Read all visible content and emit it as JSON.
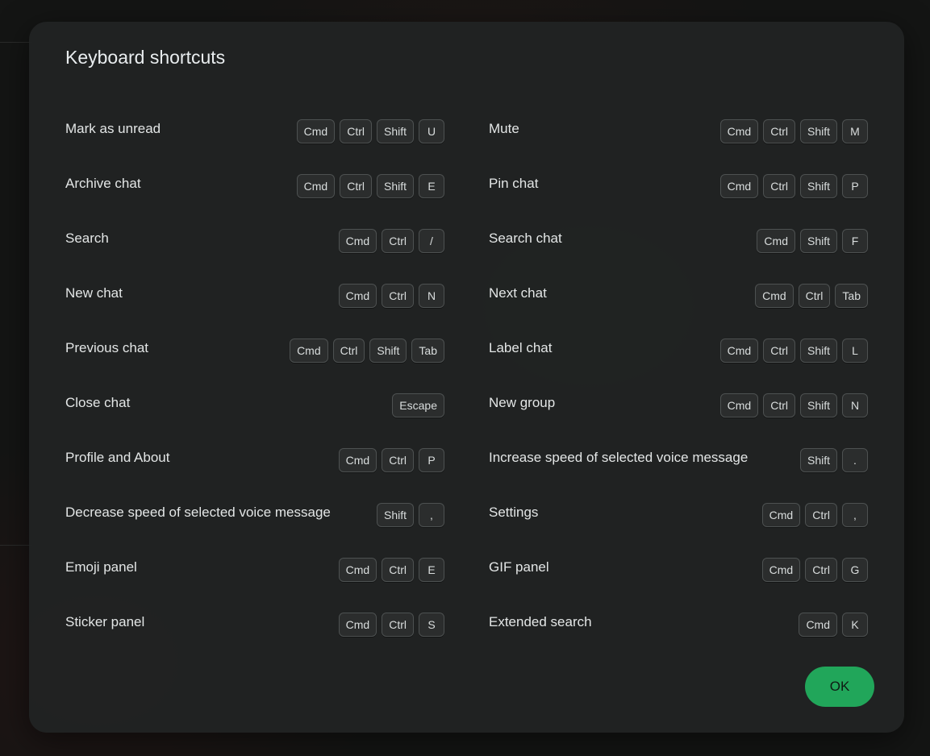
{
  "dialog": {
    "title": "Keyboard shortcuts",
    "ok_label": "OK"
  },
  "shortcuts": [
    {
      "label": "Mark as unread",
      "keys": [
        "Cmd",
        "Ctrl",
        "Shift",
        "U"
      ]
    },
    {
      "label": "Mute",
      "keys": [
        "Cmd",
        "Ctrl",
        "Shift",
        "M"
      ]
    },
    {
      "label": "Archive chat",
      "keys": [
        "Cmd",
        "Ctrl",
        "Shift",
        "E"
      ]
    },
    {
      "label": "Pin chat",
      "keys": [
        "Cmd",
        "Ctrl",
        "Shift",
        "P"
      ]
    },
    {
      "label": "Search",
      "keys": [
        "Cmd",
        "Ctrl",
        "/"
      ]
    },
    {
      "label": "Search chat",
      "keys": [
        "Cmd",
        "Shift",
        "F"
      ]
    },
    {
      "label": "New chat",
      "keys": [
        "Cmd",
        "Ctrl",
        "N"
      ]
    },
    {
      "label": "Next chat",
      "keys": [
        "Cmd",
        "Ctrl",
        "Tab"
      ]
    },
    {
      "label": "Previous chat",
      "keys": [
        "Cmd",
        "Ctrl",
        "Shift",
        "Tab"
      ]
    },
    {
      "label": "Label chat",
      "keys": [
        "Cmd",
        "Ctrl",
        "Shift",
        "L"
      ]
    },
    {
      "label": "Close chat",
      "keys": [
        "Escape"
      ]
    },
    {
      "label": "New group",
      "keys": [
        "Cmd",
        "Ctrl",
        "Shift",
        "N"
      ]
    },
    {
      "label": "Profile and About",
      "keys": [
        "Cmd",
        "Ctrl",
        "P"
      ]
    },
    {
      "label": "Increase speed of selected voice message",
      "keys": [
        "Shift",
        "."
      ]
    },
    {
      "label": "Decrease speed of selected voice message",
      "keys": [
        "Shift",
        ","
      ]
    },
    {
      "label": "Settings",
      "keys": [
        "Cmd",
        "Ctrl",
        ","
      ]
    },
    {
      "label": "Emoji panel",
      "keys": [
        "Cmd",
        "Ctrl",
        "E"
      ]
    },
    {
      "label": "GIF panel",
      "keys": [
        "Cmd",
        "Ctrl",
        "G"
      ]
    },
    {
      "label": "Sticker panel",
      "keys": [
        "Cmd",
        "Ctrl",
        "S"
      ]
    },
    {
      "label": "Extended search",
      "keys": [
        "Cmd",
        "K"
      ]
    }
  ],
  "colors": {
    "accent": "#21a65a",
    "dialog_background": "#212323",
    "key_border": "#4d5151"
  }
}
